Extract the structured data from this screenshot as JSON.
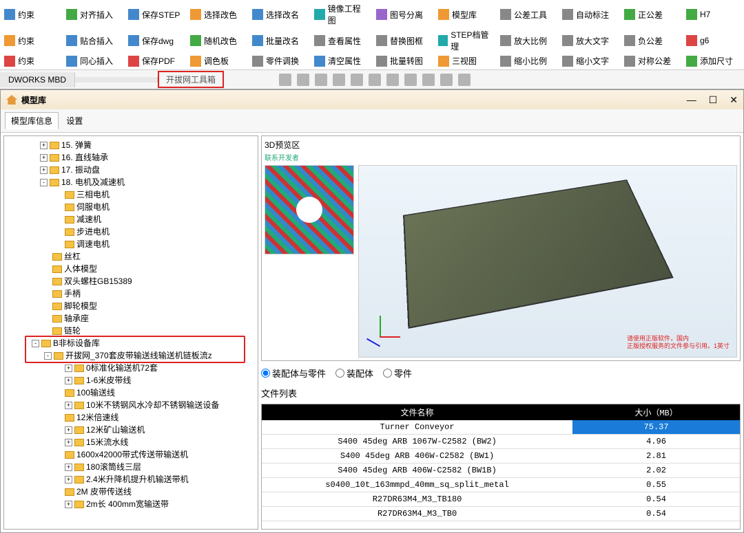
{
  "ribbon": {
    "rows": [
      [
        {
          "label": "约束",
          "icon": "ic-blue"
        },
        {
          "label": "对齐插入",
          "icon": "ic-green"
        },
        {
          "label": "保存STEP",
          "icon": "ic-blue"
        },
        {
          "label": "选择改色",
          "icon": "ic-orange"
        },
        {
          "label": "选择改名",
          "icon": "ic-blue"
        },
        {
          "label": "镜像工程图",
          "icon": "ic-teal"
        },
        {
          "label": "图号分离",
          "icon": "ic-purple"
        },
        {
          "label": "模型库",
          "icon": "ic-orange"
        },
        {
          "label": "公差工具",
          "icon": "ic-gray"
        },
        {
          "label": "自动标注",
          "icon": "ic-gray"
        },
        {
          "label": "正公差",
          "icon": "ic-green"
        },
        {
          "label": "H7",
          "icon": "ic-green"
        }
      ],
      [
        {
          "label": "约束",
          "icon": "ic-orange"
        },
        {
          "label": "贴合插入",
          "icon": "ic-blue"
        },
        {
          "label": "保存dwg",
          "icon": "ic-blue"
        },
        {
          "label": "随机改色",
          "icon": "ic-green"
        },
        {
          "label": "批量改名",
          "icon": "ic-blue"
        },
        {
          "label": "查看属性",
          "icon": "ic-gray"
        },
        {
          "label": "替换图框",
          "icon": "ic-gray"
        },
        {
          "label": "STEP档管理",
          "icon": "ic-teal"
        },
        {
          "label": "放大比例",
          "icon": "ic-gray"
        },
        {
          "label": "放大文字",
          "icon": "ic-gray"
        },
        {
          "label": "负公差",
          "icon": "ic-gray"
        },
        {
          "label": "g6",
          "icon": "ic-red"
        }
      ],
      [
        {
          "label": "约束",
          "icon": "ic-red"
        },
        {
          "label": "同心插入",
          "icon": "ic-blue"
        },
        {
          "label": "保存PDF",
          "icon": "ic-red"
        },
        {
          "label": "调色板",
          "icon": "ic-orange"
        },
        {
          "label": "零件调换",
          "icon": "ic-gray"
        },
        {
          "label": "清空属性",
          "icon": "ic-blue"
        },
        {
          "label": "批量转图",
          "icon": "ic-gray"
        },
        {
          "label": "三视图",
          "icon": "ic-orange"
        },
        {
          "label": "缩小比例",
          "icon": "ic-gray"
        },
        {
          "label": "缩小文字",
          "icon": "ic-gray"
        },
        {
          "label": "对称公差",
          "icon": "ic-gray"
        },
        {
          "label": "添加尺寸",
          "icon": "ic-green"
        }
      ]
    ]
  },
  "tabs": {
    "t1": "DWORKS MBD",
    "t2": "",
    "t3": "开拔网工具箱"
  },
  "window": {
    "title": "模型库",
    "subtabs": {
      "a": "模型库信息",
      "b": "设置"
    },
    "preview_title": "3D预览区",
    "preview_sub": "联系开发者",
    "axis": {
      "x": "X",
      "y": "Y",
      "z": "Z"
    },
    "preview_note_l1": "请使用正版软件，国内",
    "preview_note_l2": "正版授权服务的文件参与引用。1英寸",
    "radios": {
      "r1": "装配体与零件",
      "r2": "装配体",
      "r3": "零件"
    },
    "filelist": "文件列表",
    "table": {
      "h1": "文件名称",
      "h2": "大小（MB）",
      "rows": [
        {
          "name": "Turner Conveyor",
          "size": "75.37",
          "sel": true
        },
        {
          "name": "S400 45deg ARB 1067W-C2582 (BW2)",
          "size": "4.96"
        },
        {
          "name": "S400 45deg ARB 406W-C2582 (BW1)",
          "size": "2.81"
        },
        {
          "name": "S400 45deg ARB 406W-C2582 (BW1B)",
          "size": "2.02"
        },
        {
          "name": "s0400_10t_163mmpd_40mm_sq_split_metal",
          "size": "0.55"
        },
        {
          "name": "R27DR63M4_M3_TB180",
          "size": "0.54"
        },
        {
          "name": "R27DR63M4_M3_TB0",
          "size": "0.54"
        }
      ]
    }
  },
  "tree": {
    "a": [
      {
        "t": "15. 弹簧",
        "ex": "+",
        "lv": "ind1"
      },
      {
        "t": "16. 直线轴承",
        "ex": "+",
        "lv": "ind1"
      },
      {
        "t": "17. 振动盘",
        "ex": "+",
        "lv": "ind1"
      },
      {
        "t": "18. 电机及减速机",
        "ex": "-",
        "lv": "ind1"
      },
      {
        "t": "三相电机",
        "lv": "ind3"
      },
      {
        "t": "伺服电机",
        "lv": "ind3"
      },
      {
        "t": "减速机",
        "lv": "ind3"
      },
      {
        "t": "步进电机",
        "lv": "ind3"
      },
      {
        "t": "调速电机",
        "lv": "ind3"
      },
      {
        "t": "丝杠",
        "lv": "ind2"
      },
      {
        "t": "人体模型",
        "lv": "ind2"
      },
      {
        "t": "双头螺柱GB15389",
        "lv": "ind2"
      },
      {
        "t": "手柄",
        "lv": "ind2"
      },
      {
        "t": "脚轮模型",
        "lv": "ind2"
      },
      {
        "t": "轴承座",
        "lv": "ind2"
      },
      {
        "t": "链轮",
        "lv": "ind2"
      }
    ],
    "root": {
      "t": "B非标设备库",
      "ex": "-"
    },
    "hl": {
      "t": "开拔网_370套皮带输送线输送机链板流z",
      "ex": "-"
    },
    "b": [
      {
        "t": "0标准化输送机72套",
        "ex": "+",
        "lv": "ind3"
      },
      {
        "t": "1-6米皮带线",
        "ex": "+",
        "lv": "ind3"
      },
      {
        "t": "100输送线",
        "lv": "ind3"
      },
      {
        "t": "10米不锈钢风水冷却不锈钢输送设备",
        "ex": "+",
        "lv": "ind3"
      },
      {
        "t": "12米倍速线",
        "lv": "ind3"
      },
      {
        "t": "12米矿山输送机",
        "ex": "+",
        "lv": "ind3"
      },
      {
        "t": "15米流水线",
        "ex": "+",
        "lv": "ind3"
      },
      {
        "t": "1600x42000带式传送带输送机",
        "lv": "ind3"
      },
      {
        "t": "180滚筒线三层",
        "ex": "+",
        "lv": "ind3"
      },
      {
        "t": "2.4米升降机提升机输送带机",
        "ex": "+",
        "lv": "ind3"
      },
      {
        "t": "2M 皮带传送线",
        "lv": "ind3"
      },
      {
        "t": "2m长 400mm宽输送带",
        "ex": "+",
        "lv": "ind3"
      }
    ]
  }
}
